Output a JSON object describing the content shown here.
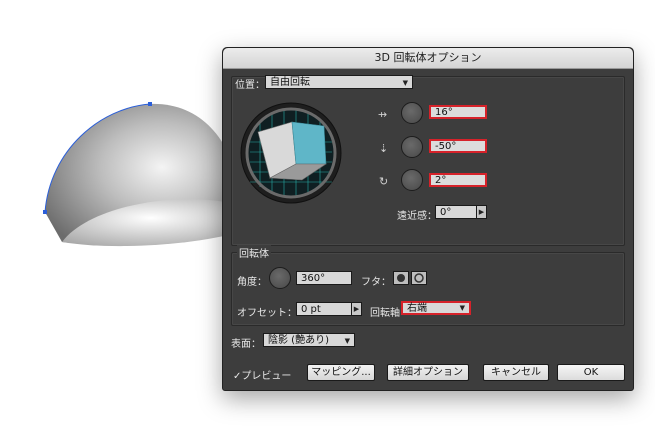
{
  "dialog": {
    "title": "3D 回転体オプション"
  },
  "position": {
    "label": "位置：",
    "preset": "自由回転",
    "x_angle": "16°",
    "y_angle": "-50°",
    "z_angle": "2°",
    "perspective_label": "遠近感：",
    "perspective_value": "0°"
  },
  "revolve": {
    "section_label": "回転体",
    "angle_label": "角度：",
    "angle_value": "360°",
    "cap_label": "フタ：",
    "offset_label": "オフセット：",
    "offset_value": "0 pt",
    "axis_label": "回転軸",
    "axis_value": "右端"
  },
  "surface": {
    "label": "表面：",
    "value": "陰影 (艶あり)"
  },
  "footer": {
    "preview_label": "✓プレビュー",
    "mapping_label": "マッピング...",
    "more_options_label": "詳細オプション",
    "cancel_label": "キャンセル",
    "ok_label": "OK"
  },
  "colors": {
    "panel_bg": "#3d3d3d",
    "highlight_border": "#d6222a",
    "cube_face": "#5fb6c8",
    "grid_line": "#2ed0c8"
  }
}
